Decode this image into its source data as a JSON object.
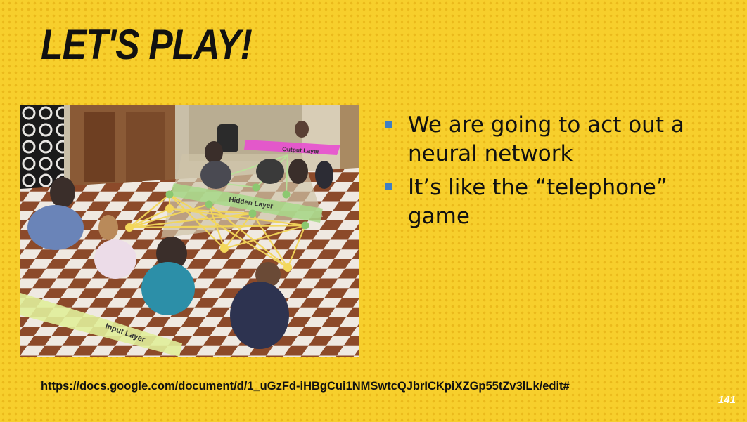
{
  "slide": {
    "title": "LET'S PLAY!",
    "bullets": [
      "We are going to act out a neural network",
      "It’s like the “telephone” game"
    ],
    "link": "https://docs.google.com/document/d/1_uGzFd-iHBgCui1NMSwtcQJbrICKpiXZGp55tZv3lLk/edit#",
    "page_number": "141"
  },
  "photo": {
    "labels": {
      "output": "Output Layer",
      "hidden": "Hidden Layer",
      "input": "Input Layer"
    }
  },
  "colors": {
    "background": "#f7cf2c",
    "bullet": "#3f7fc4",
    "output_band": "#e84fd0",
    "hidden_band": "#a8d98a",
    "input_band": "#e0ee9a",
    "connection": "#f3d75a"
  }
}
